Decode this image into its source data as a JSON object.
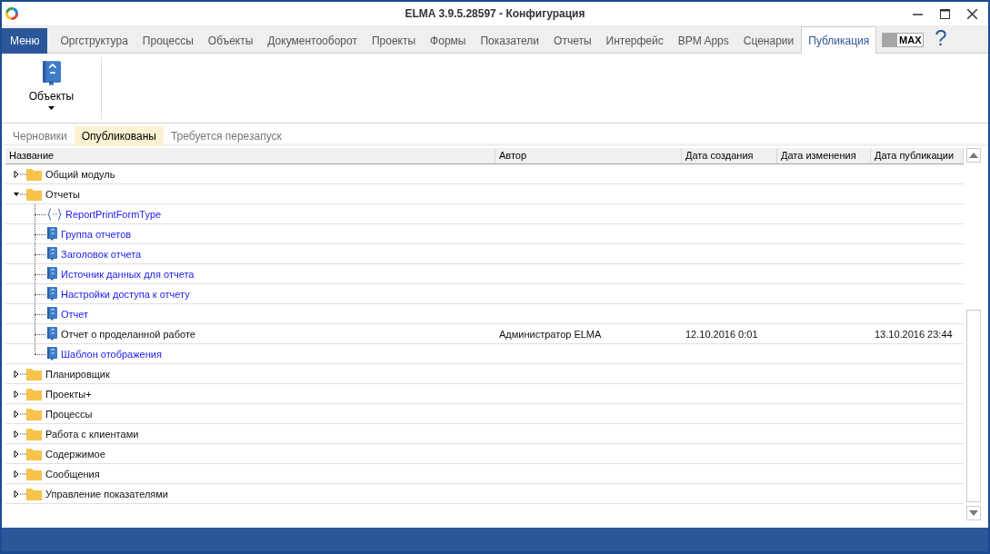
{
  "window": {
    "title": "ELMA 3.9.5.28597 - Конфигурация"
  },
  "menu_button": "Меню",
  "tabs": [
    {
      "label": "Оргструктура",
      "selected": false
    },
    {
      "label": "Процессы",
      "selected": false
    },
    {
      "label": "Объекты",
      "selected": false
    },
    {
      "label": "Документооборот",
      "selected": false
    },
    {
      "label": "Проекты",
      "selected": false
    },
    {
      "label": "Формы",
      "selected": false
    },
    {
      "label": "Показатели",
      "selected": false
    },
    {
      "label": "Отчеты",
      "selected": false
    },
    {
      "label": "Интерфейс",
      "selected": false
    },
    {
      "label": "BPM Apps",
      "selected": false
    },
    {
      "label": "Сценарии",
      "selected": false
    },
    {
      "label": "Публикация",
      "selected": true
    }
  ],
  "max_toggle": {
    "label": "MAX",
    "on": false
  },
  "help": "?",
  "ribbon": {
    "buttons": [
      {
        "label": "Объекты"
      }
    ]
  },
  "subtabs": [
    {
      "label": "Черновики",
      "selected": false
    },
    {
      "label": "Опубликованы",
      "selected": true
    },
    {
      "label": "Требуется перезапуск",
      "selected": false
    }
  ],
  "table": {
    "columns": [
      "Название",
      "Автор",
      "Дата создания",
      "Дата изменения",
      "Дата публикации"
    ],
    "rows": [
      {
        "name": "Общий модуль",
        "kind": "folder",
        "expanded": false
      },
      {
        "name": "Отчеты",
        "kind": "folder",
        "expanded": true,
        "children": [
          {
            "name": "ReportPrintFormType",
            "kind": "enum",
            "link": true
          },
          {
            "name": "Группа отчетов",
            "kind": "object",
            "link": true
          },
          {
            "name": "Заголовок отчета",
            "kind": "object",
            "link": true
          },
          {
            "name": "Источник данных для отчета",
            "kind": "object",
            "link": true
          },
          {
            "name": "Настройки доступа к отчету",
            "kind": "object",
            "link": true
          },
          {
            "name": "Отчет",
            "kind": "object",
            "link": true
          },
          {
            "name": "Отчет о проделанной работе",
            "kind": "object",
            "link": false,
            "author": "Администратор ELMA",
            "created": "12.10.2016 0:01",
            "published": "13.10.2016 23:44"
          },
          {
            "name": "Шаблон отображения",
            "kind": "object",
            "link": true
          }
        ]
      },
      {
        "name": "Планировщик",
        "kind": "folder",
        "expanded": false
      },
      {
        "name": "Проекты+",
        "kind": "folder",
        "expanded": false
      },
      {
        "name": "Процессы",
        "kind": "folder",
        "expanded": false
      },
      {
        "name": "Работа с клиентами",
        "kind": "folder",
        "expanded": false
      },
      {
        "name": "Содержимое",
        "kind": "folder",
        "expanded": false
      },
      {
        "name": "Сообщения",
        "kind": "folder",
        "expanded": false
      },
      {
        "name": "Управление показателями",
        "kind": "folder",
        "expanded": false
      }
    ]
  }
}
